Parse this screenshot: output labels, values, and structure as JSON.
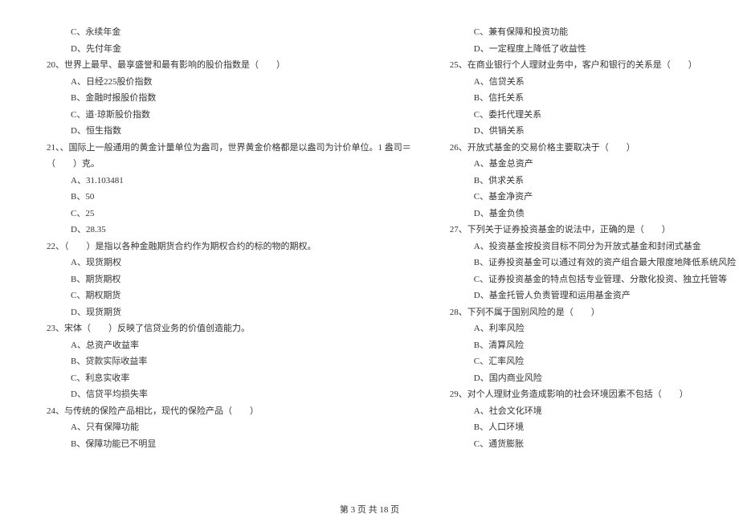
{
  "left": {
    "l1": "C、永续年金",
    "l2": "D、先付年金",
    "q20": "20、世界上最早、最享盛誉和最有影响的股价指数是（　　）",
    "q20a": "A、日经225股价指数",
    "q20b": "B、金融时报股价指数",
    "q20c": "C、道·琼斯股价指数",
    "q20d": "D、恒生指数",
    "q21": "21、、国际上一般通用的黄金计量单位为盎司，世界黄金价格都是以盎司为计价单位。1 盎司＝",
    "q21p": "（　　）克。",
    "q21a": "A、31.103481",
    "q21b": "B、50",
    "q21c": "C、25",
    "q21d": "D、28.35",
    "q22": "22、（　　）是指以各种金融期货合约作为期权合约的标的物的期权。",
    "q22a": "A、现货期权",
    "q22b": "B、期货期权",
    "q22c": "C、期权期货",
    "q22d": "D、现货期货",
    "q23": "23、宋体（　　）反映了信贷业务的价值创造能力。",
    "q23a": "A、总资产收益率",
    "q23b": "B、贷款实际收益率",
    "q23c": "C、利息实收率",
    "q23d": "D、信贷平均损失率",
    "q24": "24、与传统的保险产品相比，现代的保险产品（　　）",
    "q24a": "A、只有保障功能",
    "q24b": "B、保障功能已不明显"
  },
  "right": {
    "l1": "C、兼有保障和投资功能",
    "l2": "D、一定程度上降低了收益性",
    "q25": "25、在商业银行个人理财业务中，客户和银行的关系是（　　）",
    "q25a": "A、信贷关系",
    "q25b": "B、信托关系",
    "q25c": "C、委托代理关系",
    "q25d": "D、供销关系",
    "q26": "26、开放式基金的交易价格主要取决于（　　）",
    "q26a": "A、基金总资产",
    "q26b": "B、供求关系",
    "q26c": "C、基金净资产",
    "q26d": "D、基金负债",
    "q27": "27、下列关于证券投资基金的说法中，正确的是（　　）",
    "q27a": "A、投资基金按投资目标不同分为开放式基金和封闭式基金",
    "q27b": "B、证券投资基金可以通过有效的资产组合最大限度地降低系统风险",
    "q27c": "C、证券投资基金的特点包括专业管理、分散化投资、独立托管等",
    "q27d": "D、基金托管人负责管理和运用基金资产",
    "q28": "28、下列不属于国别风险的是（　　）",
    "q28a": "A、利率风险",
    "q28b": "B、清算风险",
    "q28c": "C、汇率风险",
    "q28d": "D、国内商业风险",
    "q29": "29、对个人理财业务造成影响的社会环境因素不包括（　　）",
    "q29a": "A、社会文化环境",
    "q29b": "B、人口环境",
    "q29c": "C、通货膨胀"
  },
  "footer": "第 3 页 共 18 页"
}
